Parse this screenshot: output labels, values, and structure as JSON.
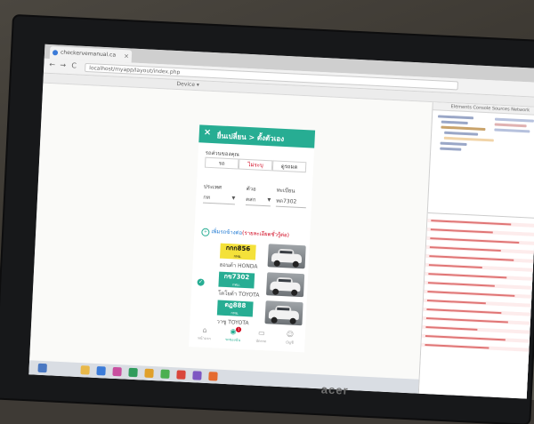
{
  "browser": {
    "tab_title": "checkervemanual.ca",
    "tab_close": "×",
    "url": "localhost/myapp/layout/index.php",
    "back": "←",
    "forward": "→",
    "reload": "C",
    "devtools_toolbar": "Device ▾"
  },
  "app": {
    "header": {
      "close_icon": "×",
      "title": "ยื่นเปลี่ยน > ตั้งตัวเอง"
    },
    "car_type_label": "รถส่วนของคุณ",
    "car_types": [
      "รถ",
      "ไม่ระบุ",
      "ดูรถมด"
    ],
    "active_car_type_index": 1,
    "province_label": "ประเทศ",
    "province_value": "กท",
    "letters_label": "ตัวอ",
    "letters_value": "ตสก",
    "number_label": "ทะเบียน",
    "number_value": "ทด7302",
    "add_link_text": "เพิ่มรถข้างต่อ",
    "add_link_note": "(รายละเอียดชั่วรู้ต่อ)",
    "vehicles": [
      {
        "plate": "กกก856",
        "province": "กทม.",
        "model": "ฮอนด้า HONDA",
        "plate_color": "#f4e13a",
        "selected": false
      },
      {
        "plate": "กข7302",
        "province": "กทม.",
        "model": "โตโยต้า TOYOTA",
        "plate_color": "#27ad93",
        "selected": true
      },
      {
        "plate": "ดฎ888",
        "province": "กทม.",
        "model": "วาซู TOYOTA",
        "plate_color": "#27ad93",
        "selected": false
      }
    ],
    "bottom_nav": [
      {
        "icon": "home-icon",
        "glyph": "⌂",
        "label": "หน้าแรก"
      },
      {
        "icon": "car-icon",
        "glyph": "◉",
        "label": "รถของฉัน",
        "badge": "1"
      },
      {
        "icon": "card-icon",
        "glyph": "▭",
        "label": "บัตรรถ"
      },
      {
        "icon": "user-icon",
        "glyph": "☺",
        "label": "บัญชี"
      }
    ],
    "active_nav_index": 1,
    "accent_color": "#27ad93",
    "alert_color": "#d0021b"
  },
  "devtools": {
    "tabs": "Elements  Console  Sources  Network"
  },
  "monitor": {
    "brand": "acer"
  }
}
